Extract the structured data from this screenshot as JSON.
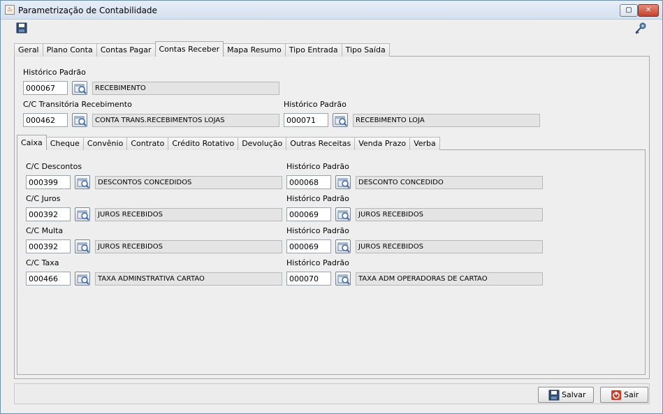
{
  "window": {
    "title": "Parametrização de Contabilidade",
    "restore_glyph": "▢",
    "close_glyph": "✕"
  },
  "main_tabs": [
    "Geral",
    "Plano Conta",
    "Contas Pagar",
    "Contas Receber",
    "Mapa Resumo",
    "Tipo Entrada",
    "Tipo Saída"
  ],
  "main_active_tab": "Contas Receber",
  "top_section": {
    "historico_label": "Histórico Padrão",
    "historico_code": "000067",
    "historico_desc": "RECEBIMENTO",
    "transitoria_label": "C/C Transitória Recebimento",
    "transitoria_code": "000462",
    "transitoria_desc": "CONTA TRANS.RECEBIMENTOS LOJAS",
    "historico2_label": "Histórico Padrão",
    "historico2_code": "000071",
    "historico2_desc": "RECEBIMENTO LOJA"
  },
  "sub_tabs": [
    "Caixa",
    "Cheque",
    "Convênio",
    "Contrato",
    "Crédito Rotativo",
    "Devolução",
    "Outras Receitas",
    "Venda Prazo",
    "Verba"
  ],
  "sub_active_tab": "Caixa",
  "caixa_rows": [
    {
      "cc_label": "C/C Descontos",
      "cc_code": "000399",
      "cc_desc": "DESCONTOS CONCEDIDOS",
      "hist_label": "Histórico Padrão",
      "hist_code": "000068",
      "hist_desc": "DESCONTO CONCEDIDO"
    },
    {
      "cc_label": "C/C Juros",
      "cc_code": "000392",
      "cc_desc": "JUROS RECEBIDOS",
      "hist_label": "Histórico Padrão",
      "hist_code": "000069",
      "hist_desc": "JUROS RECEBIDOS"
    },
    {
      "cc_label": "C/C Multa",
      "cc_code": "000392",
      "cc_desc": "JUROS RECEBIDOS",
      "hist_label": "Histórico Padrão",
      "hist_code": "000069",
      "hist_desc": "JUROS RECEBIDOS"
    },
    {
      "cc_label": "C/C Taxa",
      "cc_code": "000466",
      "cc_desc": "TAXA ADMINSTRATIVA CARTAO",
      "hist_label": "Histórico Padrão",
      "hist_code": "000070",
      "hist_desc": "TAXA ADM OPERADORAS DE CARTAO"
    }
  ],
  "buttons": {
    "save": "Salvar",
    "exit": "Sair"
  },
  "icons": {
    "toolbar_save": "floppy-icon",
    "toolbar_key": "key-icon",
    "lookup": "search-icon"
  },
  "colors": {
    "accent": "#6b8fb3",
    "exit_icon": "#d23b2a"
  }
}
